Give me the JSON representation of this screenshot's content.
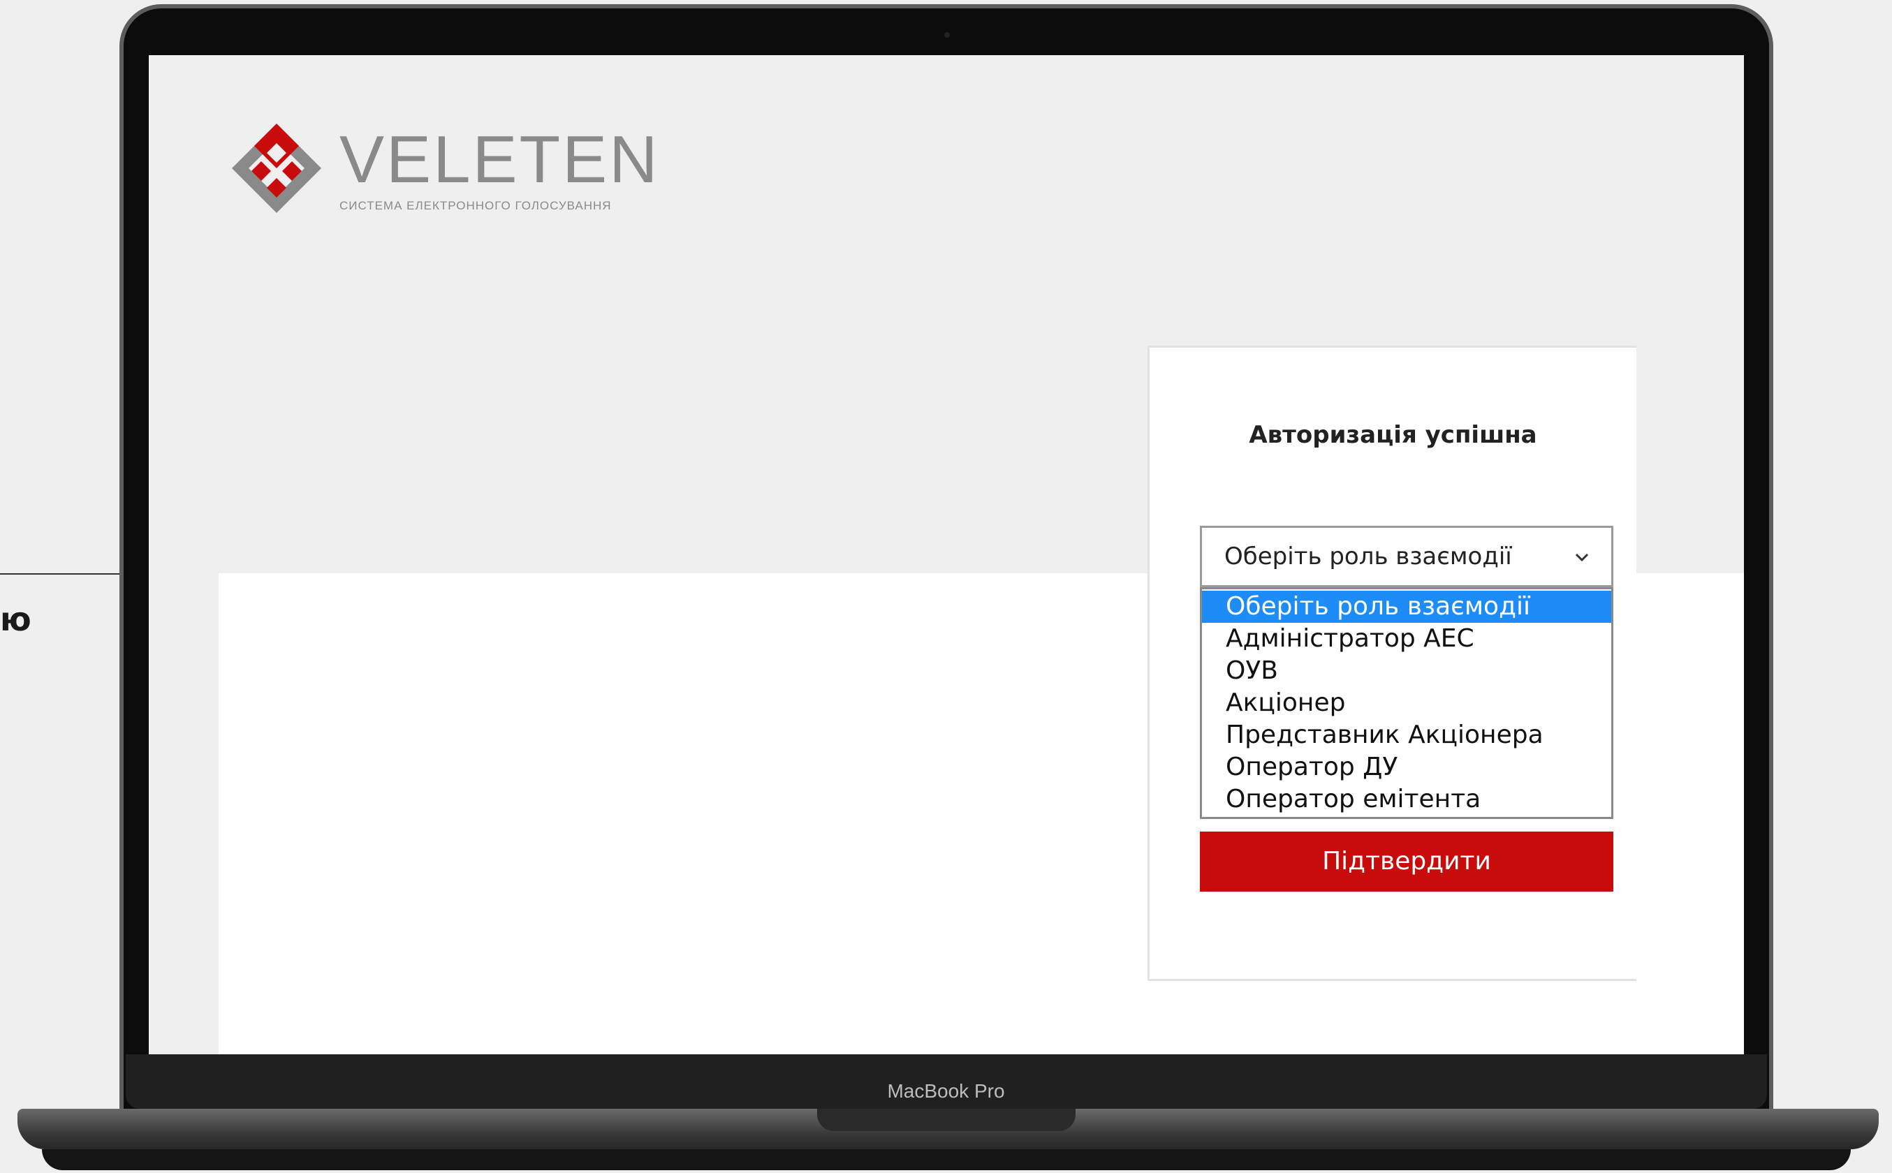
{
  "background_text": "ю",
  "device": {
    "label": "MacBook Pro"
  },
  "logo": {
    "title": "VELETEN",
    "subtitle": "СИСТЕМА ЕЛЕКТРОННОГО ГОЛОСУВАННЯ",
    "brand_color": "#c80c0c",
    "mark_color": "#8a8a8a"
  },
  "login": {
    "title": "Авторизація успішна",
    "select": {
      "value": "Оберіть роль взаємодії",
      "options": [
        "Оберіть роль взаємодії",
        "Адміністратор АЕС",
        "ОУВ",
        "Акціонер",
        "Представник Акціонера",
        "Оператор ДУ",
        "Оператор емітента"
      ],
      "highlighted_color": "#1e8cf6"
    },
    "confirm_label": "Підтвердити",
    "confirm_color": "#c80c0c"
  }
}
